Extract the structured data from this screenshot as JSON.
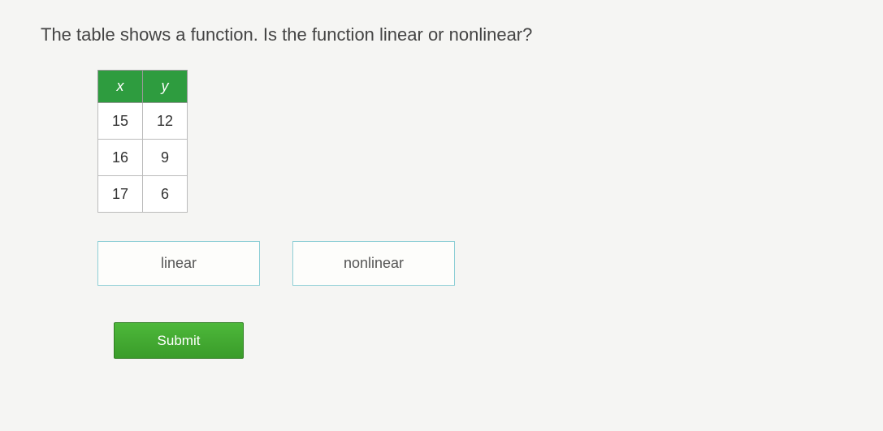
{
  "question": "The table shows a function. Is the function linear or nonlinear?",
  "table": {
    "headers": {
      "x": "x",
      "y": "y"
    },
    "rows": [
      {
        "x": "15",
        "y": "12"
      },
      {
        "x": "16",
        "y": "9"
      },
      {
        "x": "17",
        "y": "6"
      }
    ]
  },
  "answers": {
    "option1": "linear",
    "option2": "nonlinear"
  },
  "submit_label": "Submit"
}
